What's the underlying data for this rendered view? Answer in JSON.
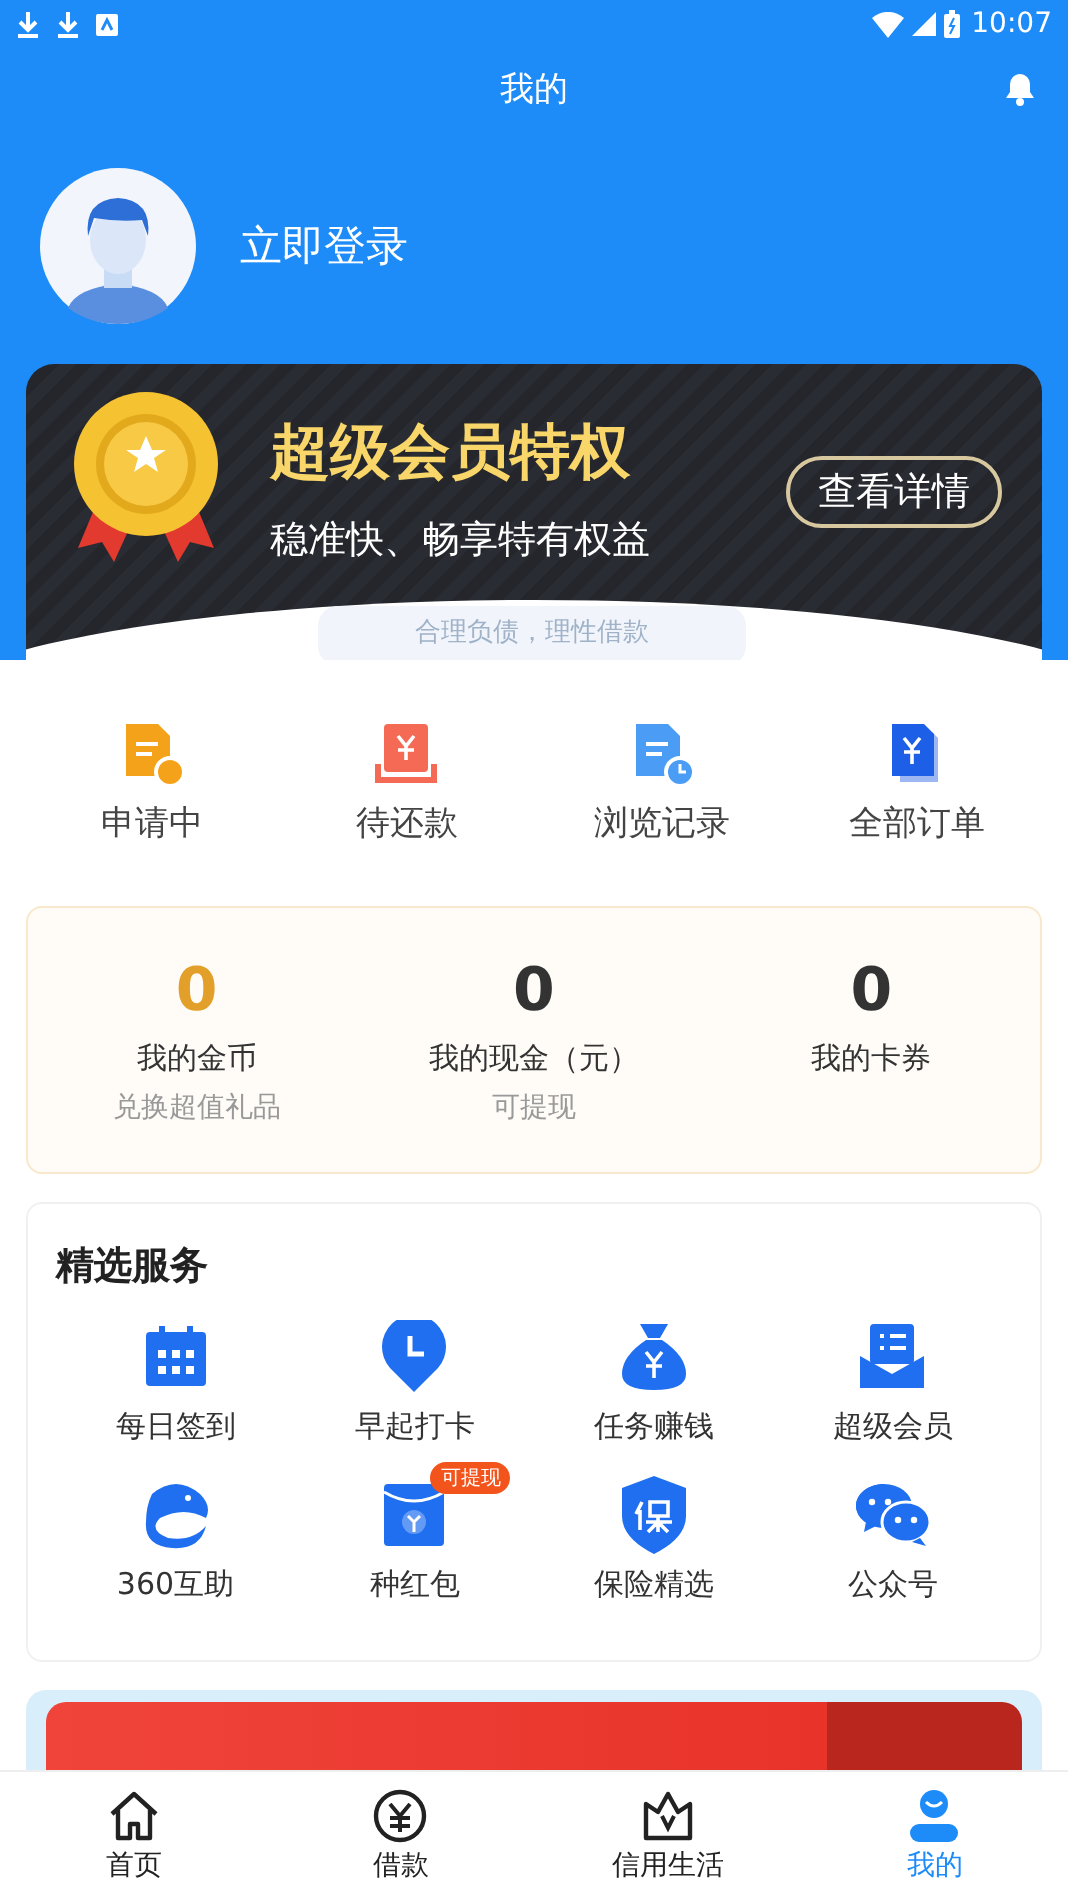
{
  "status_bar": {
    "time": "10:07"
  },
  "header": {
    "title": "我的"
  },
  "profile": {
    "login": "立即登录"
  },
  "vip_banner": {
    "title": "超级会员特权",
    "subtitle": "稳准快、畅享特有权益",
    "button": "查看详情",
    "slogan": "合理负债，理性借款"
  },
  "quick_links": [
    {
      "label": "申请中"
    },
    {
      "label": "待还款"
    },
    {
      "label": "浏览记录"
    },
    {
      "label": "全部订单"
    }
  ],
  "stats": [
    {
      "value": "0",
      "label": "我的金币",
      "note": "兑换超值礼品",
      "highlight": true
    },
    {
      "value": "0",
      "label": "我的现金（元）",
      "note": "可提现",
      "highlight": false
    },
    {
      "value": "0",
      "label": "我的卡券",
      "highlight": false
    }
  ],
  "services": {
    "title": "精选服务",
    "items": [
      {
        "label": "每日签到"
      },
      {
        "label": "早起打卡"
      },
      {
        "label": "任务赚钱"
      },
      {
        "label": "超级会员"
      },
      {
        "label": "360互助"
      },
      {
        "label": "种红包",
        "badge": "可提现"
      },
      {
        "label": "保险精选"
      },
      {
        "label": "公众号"
      }
    ]
  },
  "tab_bar": [
    {
      "label": "首页",
      "selected": false
    },
    {
      "label": "借款",
      "selected": false
    },
    {
      "label": "信用生活",
      "selected": false
    },
    {
      "label": "我的",
      "selected": true
    }
  ]
}
